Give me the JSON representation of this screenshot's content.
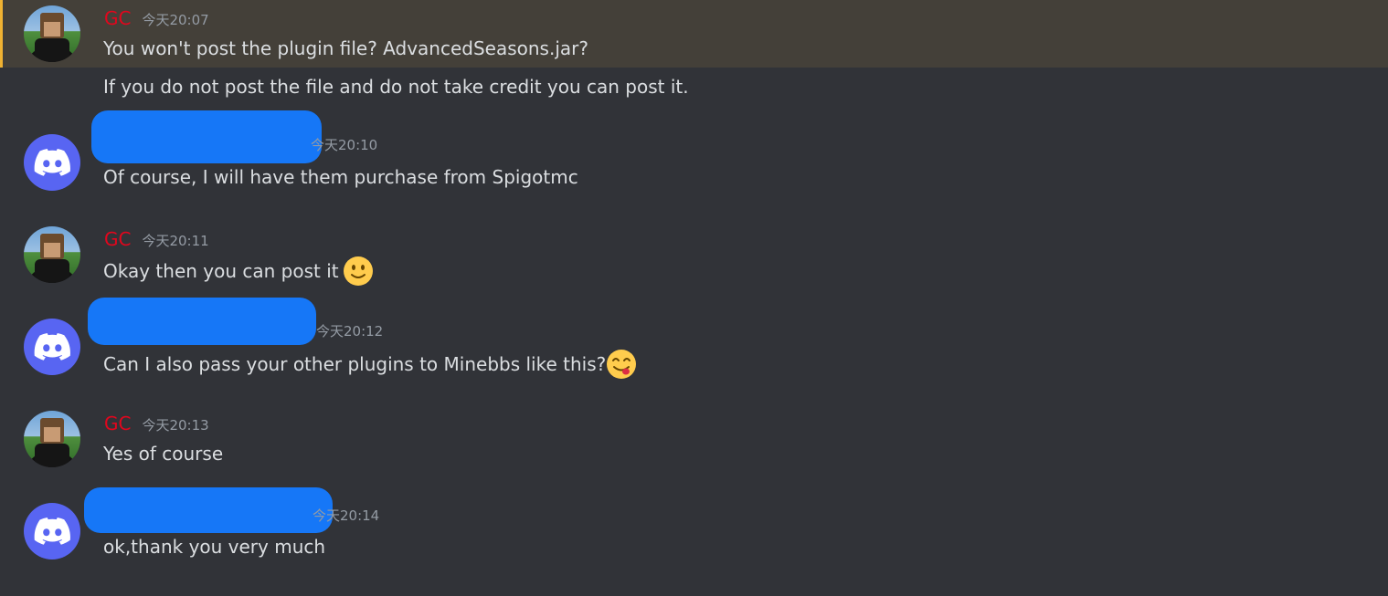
{
  "messages": [
    {
      "author": "GC",
      "avatar": "minecraft-skin-avatar",
      "timestamp": "今天20:07",
      "lines": [
        "You won't post the plugin file? AdvancedSeasons.jar?",
        "If you do not post the file and do not take credit you can post it."
      ],
      "highlighted": true
    },
    {
      "author": "",
      "avatar": "discord-logo-avatar",
      "timestamp": "今天20:10",
      "lines": [
        "Of course, I will have them purchase from Spigotmc"
      ],
      "username_redacted": true
    },
    {
      "author": "GC",
      "avatar": "minecraft-skin-avatar",
      "timestamp": "今天20:11",
      "lines": [
        "Okay then you can post it"
      ],
      "emoji": "slightly-smiling-face-emoji"
    },
    {
      "author": "",
      "avatar": "discord-logo-avatar",
      "timestamp": "今天20:12",
      "lines": [
        "Can I also pass your other plugins to Minebbs like this?"
      ],
      "emoji": "yum-face-emoji",
      "username_redacted": true
    },
    {
      "author": "GC",
      "avatar": "minecraft-skin-avatar",
      "timestamp": "今天20:13",
      "lines": [
        "Yes of course"
      ]
    },
    {
      "author": "",
      "avatar": "discord-logo-avatar",
      "timestamp": "今天20:14",
      "lines": [
        "ok,thank you very much"
      ],
      "username_redacted": true
    }
  ],
  "colors": {
    "background": "#313338",
    "highlight_background": "#444039",
    "highlight_bar": "#f0b232",
    "gc_username": "#e1061d",
    "timestamp": "#949ba4",
    "message_text": "#dbdee1",
    "discord_blurple": "#5865f2",
    "redaction": "#1677f7"
  }
}
